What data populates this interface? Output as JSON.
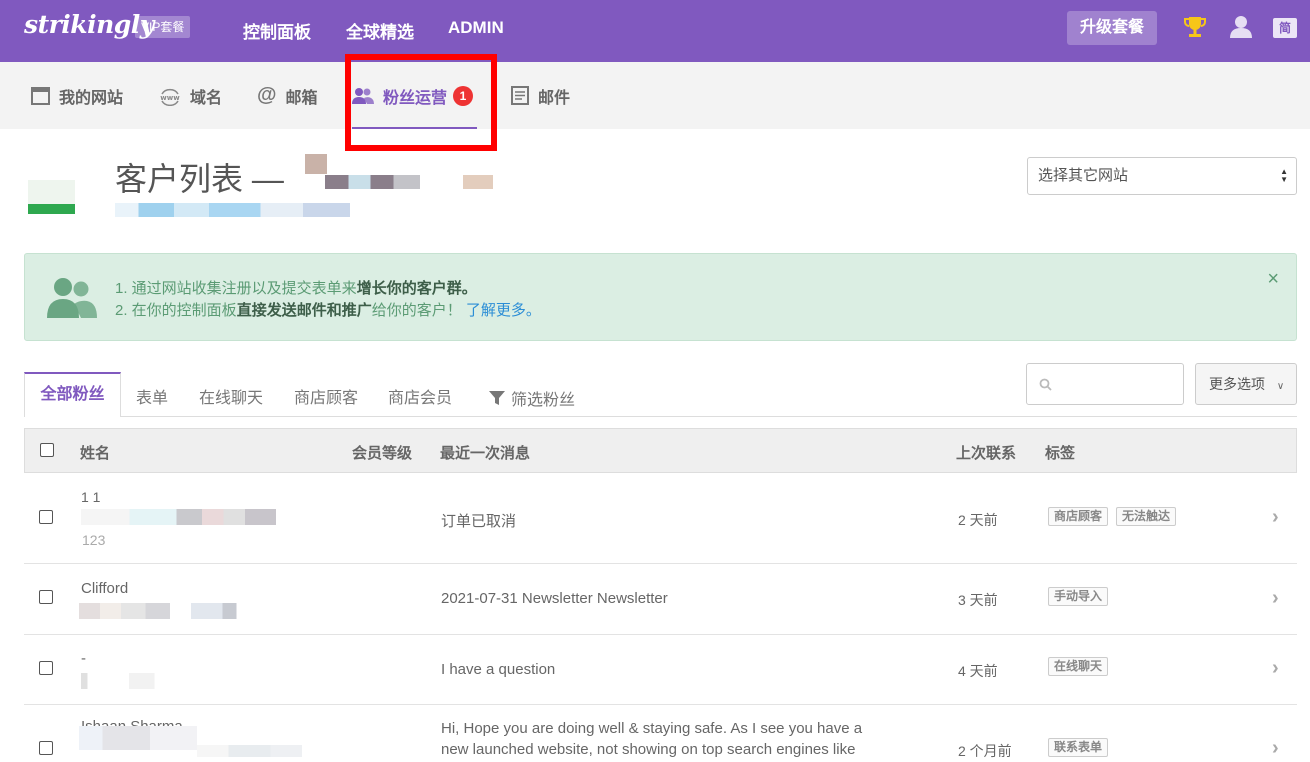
{
  "topbar": {
    "logo": "strikingly",
    "vip_label": "VIP套餐",
    "nav": [
      "控制面板",
      "全球精选",
      "ADMIN"
    ],
    "upgrade_label": "升级套餐",
    "lang_label": "简",
    "accent_color": "#8059bf"
  },
  "subnav": {
    "items": [
      {
        "label": "我的网站",
        "icon": "browser-window-icon"
      },
      {
        "label": "域名",
        "icon": "www-icon"
      },
      {
        "label": "邮箱",
        "icon": "at-icon"
      },
      {
        "label": "粉丝运营",
        "icon": "users-icon",
        "badge": "1",
        "active": true
      },
      {
        "label": "邮件",
        "icon": "document-icon"
      }
    ]
  },
  "page": {
    "title": "客户列表 —",
    "site_select": "选择其它网站"
  },
  "infobox": {
    "line1_prefix": "1. 通过网站收集注册以及提交表单来",
    "line1_bold": "增长你的客户群。",
    "line2_prefix": "2. 在你的控制面板",
    "line2_bold": "直接发送邮件和推广",
    "line2_suffix": "给你的客户！",
    "line2_link": "了解更多。",
    "close": "×"
  },
  "tabs": {
    "items": [
      "全部粉丝",
      "表单",
      "在线聊天",
      "商店顾客",
      "商店会员"
    ],
    "filter_label": "筛选粉丝",
    "more_label": "更多选项"
  },
  "table": {
    "headers": [
      "姓名",
      "会员等级",
      "最近一次消息",
      "上次联系",
      "标签"
    ],
    "rows": [
      {
        "name": "1 1",
        "sub": "123",
        "message": "订单已取消",
        "last": "2 天前",
        "tags": [
          "商店顾客",
          "无法触达"
        ]
      },
      {
        "name": "Clifford",
        "message": "2021-07-31 Newsletter Newsletter",
        "last": "3 天前",
        "tags": [
          "手动导入"
        ]
      },
      {
        "name": "-",
        "message": "I have a question",
        "last": "4 天前",
        "tags": [
          "在线聊天"
        ]
      },
      {
        "name": "Ishaan Sharma",
        "message_line1": "Hi, Hope you are doing well & staying safe. As I see you have a",
        "message_line2": "new launched website, not showing on top search engines like",
        "last": "2 个月前",
        "tags": [
          "联系表单"
        ]
      }
    ]
  }
}
